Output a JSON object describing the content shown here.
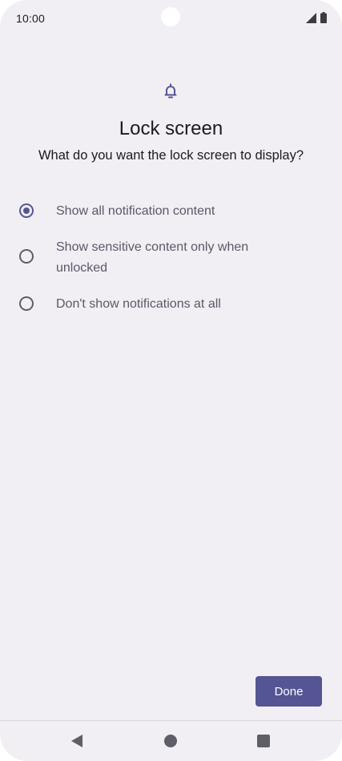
{
  "status_bar": {
    "time": "10:00",
    "icons": [
      "signal-icon",
      "battery-icon"
    ]
  },
  "header": {
    "icon": "bell-icon",
    "title": "Lock screen",
    "subtitle": "What do you want the lock screen to display?"
  },
  "options": [
    {
      "label": "Show all notification content",
      "selected": true
    },
    {
      "label": "Show sensitive content only when unlocked",
      "selected": false
    },
    {
      "label": "Don't show notifications at all",
      "selected": false
    }
  ],
  "actions": {
    "done_label": "Done"
  },
  "nav_bar": {
    "icons": [
      "back-icon",
      "home-icon",
      "recents-icon"
    ]
  },
  "colors": {
    "accent": "#545592",
    "background": "#f1eff4",
    "text_primary": "#1c1b1f",
    "text_secondary": "#5a5866"
  }
}
